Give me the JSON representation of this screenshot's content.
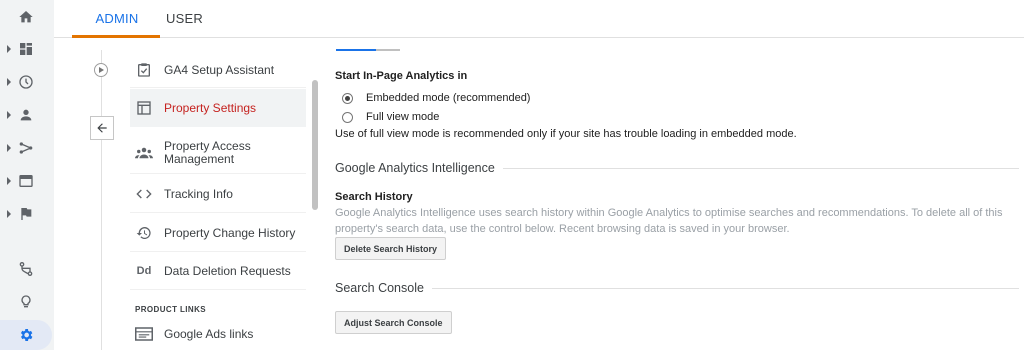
{
  "tabs": {
    "admin": "ADMIN",
    "user": "USER"
  },
  "rail": {
    "items": [
      {
        "icon": "home-icon"
      },
      {
        "icon": "dashboard-icon"
      },
      {
        "icon": "clock-icon"
      },
      {
        "icon": "person-icon"
      },
      {
        "icon": "acquisition-icon"
      },
      {
        "icon": "behavior-icon"
      },
      {
        "icon": "flag-icon"
      },
      {
        "icon": "attribution-icon"
      },
      {
        "icon": "lightbulb-icon"
      },
      {
        "icon": "gear-icon"
      }
    ]
  },
  "menu": {
    "items": [
      {
        "label": "GA4 Setup Assistant",
        "icon": "checkbox-icon"
      },
      {
        "label": "Property Settings",
        "icon": "layout-icon",
        "active": true
      },
      {
        "label": "Property Access Management",
        "icon": "people-icon"
      },
      {
        "label": "Tracking Info",
        "icon": "code-icon"
      },
      {
        "label": "Property Change History",
        "icon": "history-icon"
      },
      {
        "label": "Data Deletion Requests",
        "icon": "dd-icon"
      }
    ],
    "section_product_links": "PRODUCT LINKS",
    "product_links": [
      {
        "label": "Google Ads links",
        "icon": "ads-icon"
      }
    ]
  },
  "content": {
    "in_page_heading": "Start In-Page Analytics in",
    "radio_embedded": "Embedded mode (recommended)",
    "radio_full": "Full view mode",
    "radio_selected": "Embedded mode (recommended)",
    "note": "Use of full view mode is recommended only if your site has trouble loading in embedded mode.",
    "intelligence_title": "Google Analytics Intelligence",
    "search_history_heading": "Search History",
    "search_history_desc": "Google Analytics Intelligence uses search history within Google Analytics to optimise searches and recommendations. To delete all of this property's search data, use the control below. Recent browsing data is saved in your browser.",
    "delete_button": "Delete Search History",
    "search_console_title": "Search Console",
    "adjust_button": "Adjust Search Console"
  },
  "colors": {
    "accent_blue": "#1a73e8",
    "active_red": "#c5221f",
    "tab_underline": "#e37400"
  }
}
